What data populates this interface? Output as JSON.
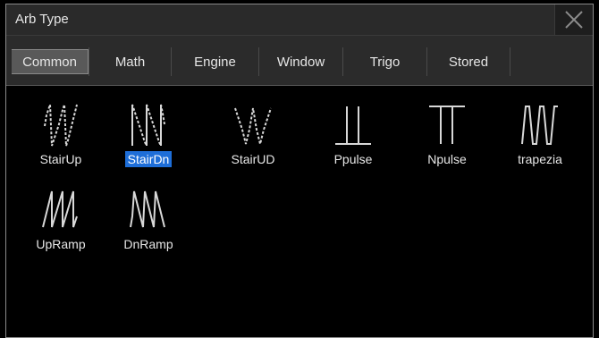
{
  "dialog": {
    "title": "Arb Type"
  },
  "tabs": [
    {
      "label": "Common",
      "active": true
    },
    {
      "label": "Math"
    },
    {
      "label": "Engine"
    },
    {
      "label": "Window"
    },
    {
      "label": "Trigo"
    },
    {
      "label": "Stored"
    }
  ],
  "items": [
    {
      "label": "StairUp",
      "icon": "stairup-waveform-icon"
    },
    {
      "label": "StairDn",
      "icon": "stairdn-waveform-icon",
      "selected": true
    },
    {
      "label": "StairUD",
      "icon": "stairud-waveform-icon"
    },
    {
      "label": "Ppulse",
      "icon": "ppulse-waveform-icon"
    },
    {
      "label": "Npulse",
      "icon": "npulse-waveform-icon"
    },
    {
      "label": "trapezia",
      "icon": "trapezia-waveform-icon"
    },
    {
      "label": "UpRamp",
      "icon": "upramp-waveform-icon"
    },
    {
      "label": "DnRamp",
      "icon": "dnramp-waveform-icon"
    }
  ],
  "colors": {
    "selection": "#1e6ed8",
    "text": "#e6e6e6",
    "titlebar": "#2a2a2a"
  }
}
